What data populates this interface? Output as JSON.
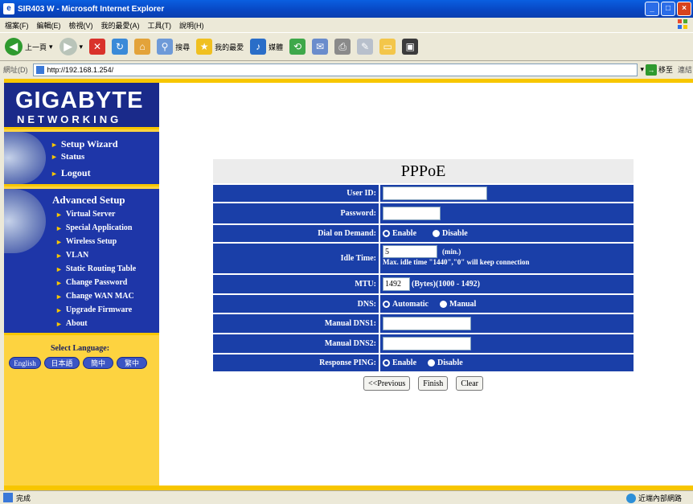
{
  "window": {
    "title": "SIR403 W - Microsoft Internet Explorer",
    "controls": [
      "_",
      "□",
      "×"
    ]
  },
  "menubar": {
    "items": [
      "檔案(F)",
      "編輯(E)",
      "檢視(V)",
      "我的最愛(A)",
      "工具(T)",
      "說明(H)"
    ]
  },
  "toolbar": {
    "back_label": "上一頁",
    "search_label": "搜尋",
    "favorites_label": "我的最愛",
    "media_label": "媒體"
  },
  "addressbar": {
    "label": "網址(D)",
    "url": "http://192.168.1.254/",
    "go_label": "移至",
    "links_label": "連結"
  },
  "sidebar": {
    "logo_main": "GIGABYTE",
    "logo_sub": "NETWORKING",
    "nav_top": [
      "Setup Wizard",
      "Status",
      "Logout"
    ],
    "advanced_title": "Advanced Setup",
    "advanced_items": [
      "Virtual Server",
      "Special Application",
      "Wireless Setup",
      "VLAN",
      "Static Routing Table",
      "Change Password",
      "Change WAN MAC",
      "Upgrade Firmware",
      "About"
    ],
    "language_title": "Select Language:",
    "languages": [
      "English",
      "日本語",
      "簡中",
      "繁中"
    ]
  },
  "form": {
    "title": "PPPoE",
    "user_id_label": "User ID:",
    "user_id_value": "",
    "password_label": "Password:",
    "password_value": "",
    "dial_label": "Dial on Demand:",
    "dial_enable": "Enable",
    "dial_disable": "Disable",
    "idle_label": "Idle Time:",
    "idle_value": "5",
    "idle_unit": "(min.)",
    "idle_hint": "Max. idle time \"1440\",\"0\" will keep connection",
    "mtu_label": "MTU:",
    "mtu_value": "1492",
    "mtu_hint": "(Bytes)(1000 - 1492)",
    "dns_label": "DNS:",
    "dns_auto": "Automatic",
    "dns_manual": "Manual",
    "dns1_label": "Manual DNS1:",
    "dns1_value": "",
    "dns2_label": "Manual DNS2:",
    "dns2_value": "",
    "ping_label": "Response PING:",
    "ping_enable": "Enable",
    "ping_disable": "Disable",
    "btn_previous": "<<Previous",
    "btn_finish": "Finish",
    "btn_clear": "Clear"
  },
  "statusbar": {
    "status": "完成",
    "zone": "近端內部網路"
  },
  "colors": {
    "navy": "#1e36a8",
    "form_row": "#1a3fa8",
    "yellow": "#f7c600",
    "title_blue": "#0846c2"
  }
}
